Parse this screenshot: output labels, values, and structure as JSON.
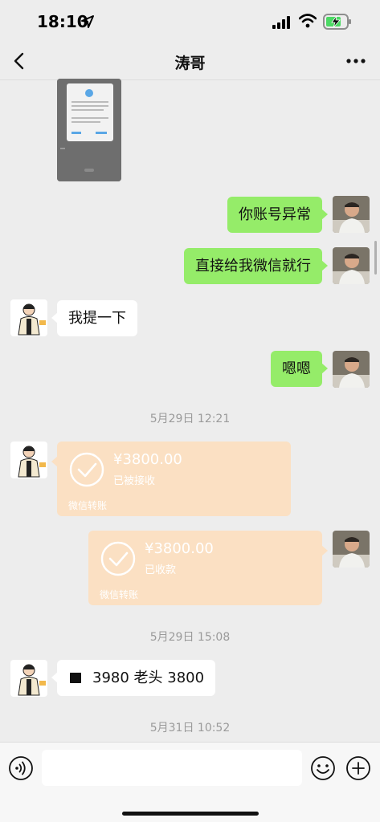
{
  "status_bar": {
    "time": "18:10",
    "icons": [
      "location-arrow-icon",
      "cellular-signal-icon",
      "wifi-icon",
      "battery-charging-icon"
    ]
  },
  "nav": {
    "title": "涛哥",
    "back_icon": "chevron-left-icon",
    "more_icon": "more-dots-icon"
  },
  "messages": [
    {
      "side": "left",
      "type": "image"
    },
    {
      "side": "right",
      "type": "text",
      "text": "你账号异常"
    },
    {
      "side": "right",
      "type": "text",
      "text": "直接给我微信就行"
    },
    {
      "side": "left",
      "type": "text",
      "text": "我提一下"
    },
    {
      "side": "right",
      "type": "text",
      "text": "嗯嗯"
    },
    {
      "type": "timestamp",
      "text": "5月29日 12:21"
    },
    {
      "side": "left",
      "type": "transfer",
      "amount": "¥3800.00",
      "status": "已被接收",
      "footer": "微信转账"
    },
    {
      "side": "right",
      "type": "transfer",
      "amount": "¥3800.00",
      "status": "已收款",
      "footer": "微信转账"
    },
    {
      "type": "timestamp",
      "text": "5月29日 15:08"
    },
    {
      "side": "left",
      "type": "text",
      "text": "3980 老头 3800"
    },
    {
      "type": "timestamp",
      "text": "5月31日 10:52"
    }
  ],
  "input_bar": {
    "placeholder": "",
    "icons": [
      "voice-icon",
      "emoji-icon",
      "plus-icon"
    ]
  },
  "colors": {
    "background": "#ededed",
    "bubble_sent": "#95ec69",
    "bubble_received": "#ffffff",
    "transfer_card": "#fbe0c3"
  }
}
